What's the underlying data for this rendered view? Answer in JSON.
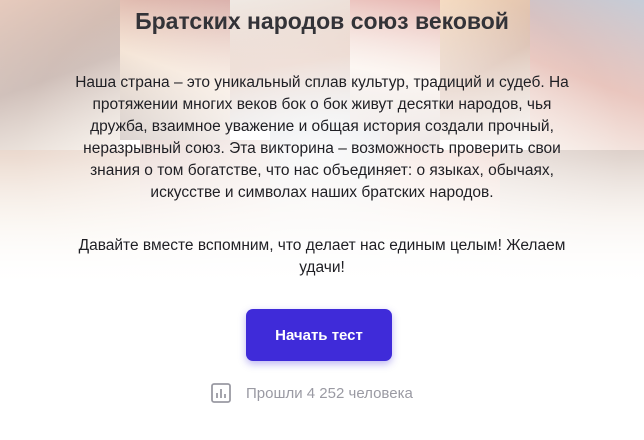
{
  "quiz": {
    "title": "Братских народов союз вековой",
    "intro": "Наша страна – это уникальный сплав культур, традиций и судеб. На протяжении многих веков бок о бок живут десятки народов, чья дружба, взаимное уважение и общая история создали прочный, неразрывный союз. Эта викторина – возможность проверить свои знания о том богатстве, что нас объединяет: о языках, обычаях, искусстве и символах наших братских народов.",
    "outro": "Давайте вместе вспомним, что делает нас единым целым! Желаем удачи!",
    "start_button_label": "Начать тест",
    "stats_text": "Прошли 4 252 человека",
    "stats_icon": "bar-chart-icon"
  },
  "colors": {
    "accent": "#3f2bd9",
    "title": "#333338",
    "body_text": "#1f1f24",
    "muted": "#9a9aa3"
  }
}
